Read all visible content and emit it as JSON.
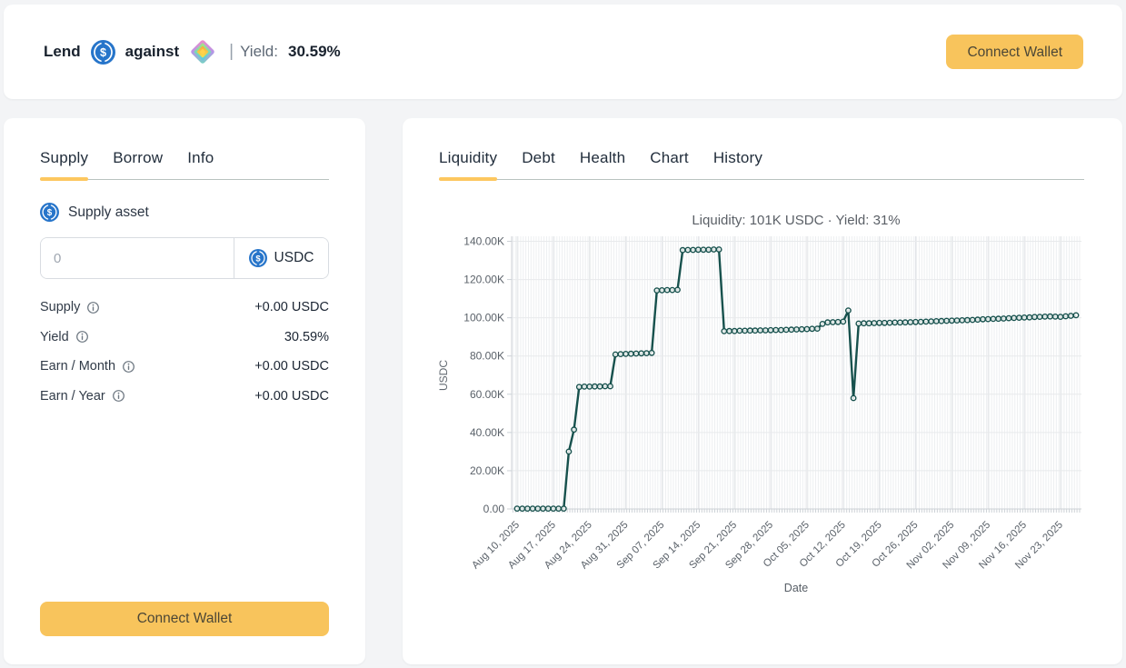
{
  "header": {
    "lend_label": "Lend",
    "against_label": "against",
    "separator": "|",
    "yield_label": "Yield:",
    "yield_value": "30.59%",
    "connect_wallet_label": "Connect Wallet",
    "lend_asset_icon": "usdc-icon",
    "against_asset_icon": "gem-icon"
  },
  "supply_panel": {
    "tabs": [
      {
        "label": "Supply",
        "active": true
      },
      {
        "label": "Borrow",
        "active": false
      },
      {
        "label": "Info",
        "active": false
      }
    ],
    "supply_asset_label": "Supply asset",
    "input": {
      "placeholder": "0",
      "token": "USDC"
    },
    "rows": [
      {
        "label": "Supply",
        "value": "+0.00 USDC"
      },
      {
        "label": "Yield",
        "value": "30.59%"
      },
      {
        "label": "Earn / Month",
        "value": "+0.00 USDC"
      },
      {
        "label": "Earn / Year",
        "value": "+0.00 USDC"
      }
    ],
    "connect_wallet_label": "Connect Wallet"
  },
  "chart_panel": {
    "tabs": [
      {
        "label": "Liquidity",
        "active": true
      },
      {
        "label": "Debt",
        "active": false
      },
      {
        "label": "Health",
        "active": false
      },
      {
        "label": "Chart",
        "active": false
      },
      {
        "label": "History",
        "active": false
      }
    ]
  },
  "colors": {
    "accent_button": "#f8c45c",
    "tab_underline": "#fdc75f",
    "usdc_blue": "#2775ca",
    "chart_line": "#17514d",
    "card_bg": "#ffffff",
    "page_bg": "#f3f4f6"
  },
  "chart_data": {
    "type": "line",
    "title": "Liquidity: 101K USDC · Yield: 31%",
    "xlabel": "Date",
    "ylabel": "USDC",
    "ylim": [
      0,
      140000
    ],
    "grid": true,
    "legend": false,
    "line_color": "#17514d",
    "marker": "open-circle",
    "x_start_date": "Aug 10, 2025",
    "x_interval": "daily",
    "x_tick_labels": [
      "Aug 10, 2025",
      "Aug 17, 2025",
      "Aug 24, 2025",
      "Aug 31, 2025",
      "Sep 07, 2025",
      "Sep 14, 2025",
      "Sep 21, 2025",
      "Sep 28, 2025",
      "Oct 05, 2025",
      "Oct 12, 2025",
      "Oct 19, 2025",
      "Oct 26, 2025",
      "Nov 02, 2025",
      "Nov 09, 2025",
      "Nov 16, 2025",
      "Nov 23, 2025"
    ],
    "x_tick_every_days": 7,
    "ytick_labels": [
      "0.00",
      "20.00K",
      "40.00K",
      "60.00K",
      "80.00K",
      "100.00K",
      "120.00K",
      "140.00K"
    ],
    "values": [
      200,
      200,
      200,
      200,
      200,
      200,
      200,
      200,
      200,
      200,
      30000,
      41500,
      63800,
      64000,
      64000,
      64100,
      64100,
      64200,
      64200,
      80800,
      81000,
      81100,
      81200,
      81300,
      81400,
      81500,
      81600,
      114300,
      114400,
      114500,
      114500,
      114600,
      135400,
      135500,
      135500,
      135600,
      135600,
      135600,
      135700,
      135700,
      93000,
      93100,
      93100,
      93200,
      93200,
      93300,
      93300,
      93400,
      93400,
      93500,
      93600,
      93600,
      93700,
      93800,
      93900,
      94000,
      94100,
      94200,
      94300,
      96800,
      97600,
      97700,
      97800,
      98000,
      103800,
      58000,
      97000,
      97100,
      97100,
      97200,
      97300,
      97300,
      97400,
      97500,
      97500,
      97600,
      97700,
      97800,
      97900,
      98000,
      98100,
      98200,
      98300,
      98400,
      98500,
      98600,
      98700,
      98800,
      98900,
      99000,
      99200,
      99300,
      99400,
      99500,
      99600,
      99800,
      99900,
      100000,
      100100,
      100200,
      100400,
      100500,
      100600,
      100700,
      100600,
      100500,
      100800,
      101000,
      101300
    ]
  }
}
